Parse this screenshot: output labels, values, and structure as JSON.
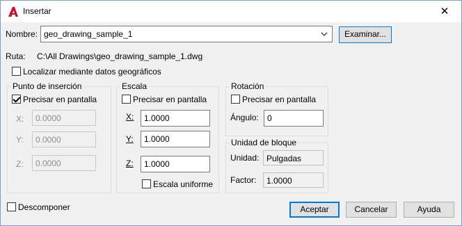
{
  "window": {
    "title": "Insertar",
    "close_glyph": "✕",
    "app_icon": "autocad-a-icon",
    "accent": "#c8102e"
  },
  "name_row": {
    "label": "Nombre:",
    "value": "geo_drawing_sample_1",
    "browse": "Examinar..."
  },
  "path_row": {
    "label": "Ruta:",
    "value": "C:\\All Drawings\\geo_drawing_sample_1.dwg"
  },
  "geo_checkbox": {
    "label": "Localizar mediante datos geográficos",
    "checked": false
  },
  "insertion": {
    "title": "Punto de inserción",
    "onscreen_label": "Precisar en pantalla",
    "onscreen_checked": true,
    "x_label": "X:",
    "x_value": "0.0000",
    "y_label": "Y:",
    "y_value": "0.0000",
    "z_label": "Z:",
    "z_value": "0.0000"
  },
  "scale": {
    "title": "Escala",
    "onscreen_label": "Precisar en pantalla",
    "onscreen_checked": false,
    "x_label": "X:",
    "x_value": "1.0000",
    "y_label": "Y:",
    "y_value": "1.0000",
    "z_label": "Z:",
    "z_value": "1.0000",
    "uniform_label": "Escala uniforme",
    "uniform_checked": false
  },
  "rotation": {
    "title": "Rotación",
    "onscreen_label": "Precisar en pantalla",
    "onscreen_checked": false,
    "angle_label": "Ángulo:",
    "angle_value": "0"
  },
  "block_unit": {
    "title": "Unidad de bloque",
    "unit_label": "Unidad:",
    "unit_value": "Pulgadas",
    "factor_label": "Factor:",
    "factor_value": "1.0000"
  },
  "explode": {
    "label": "Descomponer",
    "checked": false
  },
  "buttons": {
    "ok": "Aceptar",
    "cancel": "Cancelar",
    "help": "Ayuda"
  }
}
